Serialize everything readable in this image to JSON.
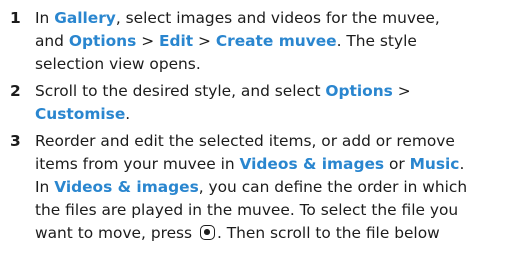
{
  "steps": [
    {
      "number": "1",
      "lines": [
        [
          "In ",
          {
            "hl": "Gallery"
          },
          ", select images and videos for the muvee,"
        ],
        [
          "and ",
          {
            "hl": "Options"
          },
          " > ",
          {
            "hl": "Edit"
          },
          " > ",
          {
            "hl": "Create muvee"
          },
          ". The style"
        ],
        [
          "selection view opens."
        ]
      ]
    },
    {
      "number": "2",
      "lines": [
        [
          "Scroll to the desired style, and select ",
          {
            "hl": "Options"
          },
          " >"
        ],
        [
          {
            "hl": "Customise"
          },
          "."
        ]
      ]
    },
    {
      "number": "3",
      "lines": [
        [
          "Reorder and edit the selected items, or add or remove"
        ],
        [
          "items from your muvee in ",
          {
            "hl": "Videos & images"
          },
          " or ",
          {
            "hl": "Music"
          },
          "."
        ],
        [
          "In ",
          {
            "hl": "Videos & images"
          },
          ", you can define the order in which"
        ],
        [
          "the files are played in the muvee. To select the file you"
        ],
        [
          "want to move, press ",
          {
            "icon": "selection-key-icon"
          },
          ". Then scroll to the file below"
        ]
      ]
    }
  ],
  "colors": {
    "highlight": "#2a86cf",
    "text": "#1c1c1c"
  }
}
